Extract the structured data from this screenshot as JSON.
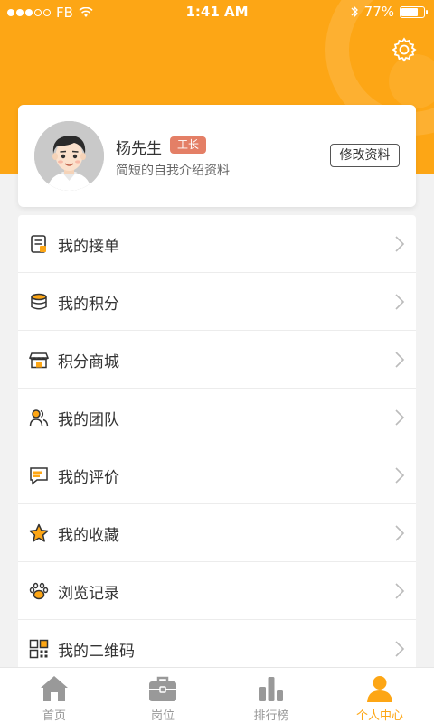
{
  "status_bar": {
    "carrier": "FB",
    "time": "1:41 AM",
    "battery_text": "77%",
    "battery_level": 0.77
  },
  "profile": {
    "name": "杨先生",
    "role_badge": "工长",
    "bio": "简短的自我介绍资料",
    "edit_label": "修改资料"
  },
  "menu": {
    "items": [
      {
        "label": "我的接单",
        "icon": "order-icon"
      },
      {
        "label": "我的积分",
        "icon": "coins-icon"
      },
      {
        "label": "积分商城",
        "icon": "store-icon"
      },
      {
        "label": "我的团队",
        "icon": "team-icon"
      },
      {
        "label": "我的评价",
        "icon": "comment-icon"
      },
      {
        "label": "我的收藏",
        "icon": "star-icon"
      },
      {
        "label": "浏览记录",
        "icon": "paw-icon"
      },
      {
        "label": "我的二维码",
        "icon": "qrcode-icon"
      }
    ]
  },
  "tabs": {
    "items": [
      {
        "label": "首页",
        "icon": "home-icon"
      },
      {
        "label": "岗位",
        "icon": "briefcase-icon"
      },
      {
        "label": "排行榜",
        "icon": "bar-chart-icon"
      },
      {
        "label": "个人中心",
        "icon": "user-icon"
      }
    ],
    "active_index": 3
  },
  "colors": {
    "brand": "#fda615",
    "badge": "#e47f66",
    "tab_inactive": "#999999"
  }
}
